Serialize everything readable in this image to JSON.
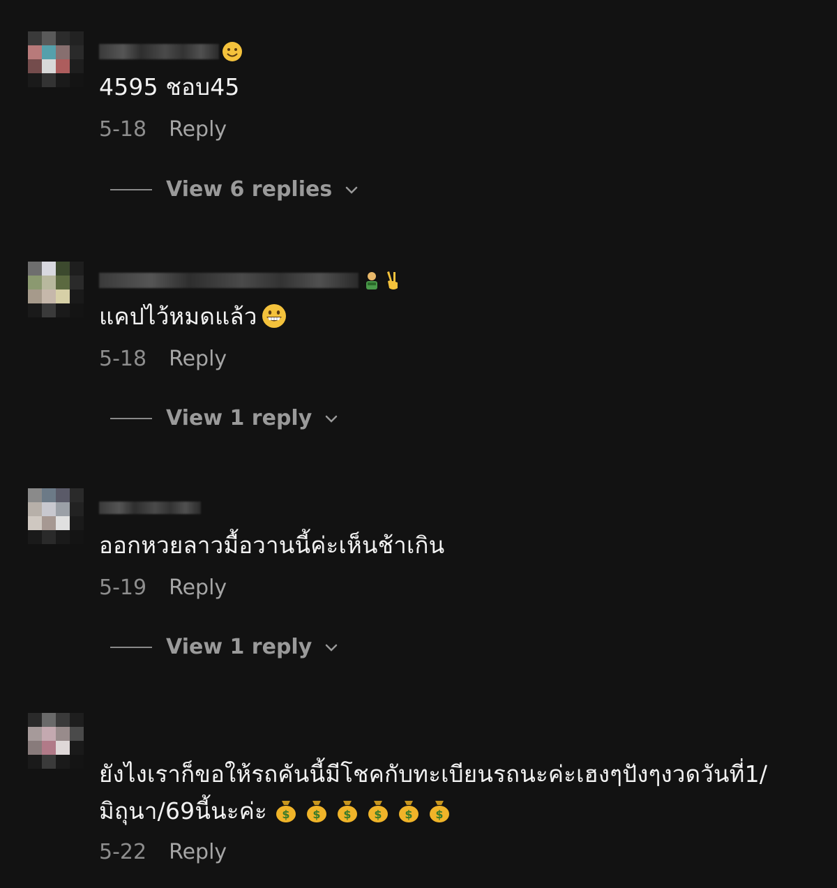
{
  "comments": [
    {
      "text": "4595 ชอบ45",
      "date": "5-18",
      "reply_label": "Reply",
      "view_replies": "View 6 replies"
    },
    {
      "text": "แคปไว้หมดแล้ว",
      "date": "5-18",
      "reply_label": "Reply",
      "view_replies": "View 1 reply"
    },
    {
      "text": "ออกหวยลาวมื้อวานนี้ค่ะเห็นช้าเกิน",
      "date": "5-19",
      "reply_label": "Reply",
      "view_replies": "View 1 reply"
    },
    {
      "text_line1": "ยังไงเราก็ขอให้รถคันนี้มีโชคกับทะเบียนรถนะค่ะเฮงๆปังๆงวดวันที่1/",
      "text_line2": "มิถุนา/69นี้นะค่ะ",
      "date": "5-22",
      "reply_label": "Reply"
    }
  ],
  "icons": {
    "grinning_face": "grinning-face-icon",
    "money_bag": "money-bag-icon",
    "chevron": "chevron-down-icon"
  },
  "colors": {
    "background": "#121212",
    "text": "#f2f2f2",
    "muted": "#8e8e8e",
    "emoji_yellow": "#f4c23c"
  }
}
